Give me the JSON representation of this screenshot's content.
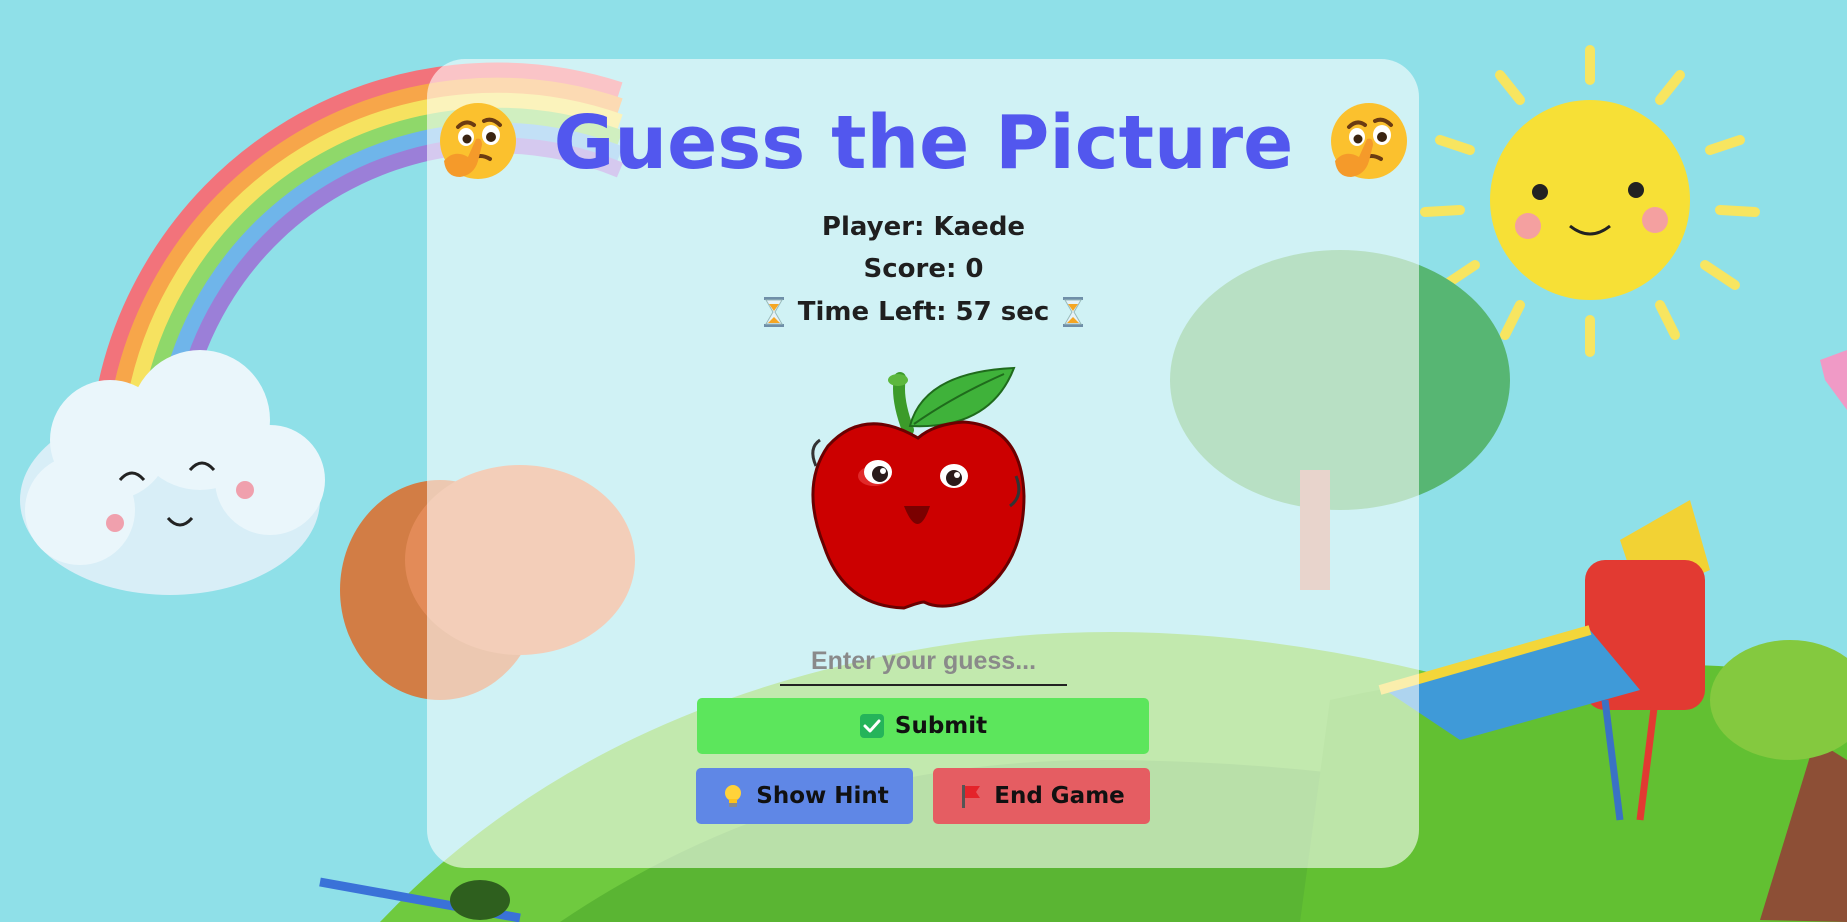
{
  "game": {
    "title": "Guess the Picture",
    "title_emoji_left": "thinking-face-emoji",
    "title_emoji_right": "thinking-face-emoji",
    "player_text": "Player: Kaede",
    "score_text": "Score: 0",
    "time_text": "Time Left: 57 sec",
    "time_icon": "hourglass-icon",
    "picture_subject_icon": "cartoon-apple-image",
    "guess": {
      "value": "",
      "placeholder": "Enter your guess..."
    },
    "buttons": {
      "submit_label": "Submit",
      "submit_icon": "check-box-icon",
      "hint_label": "Show Hint",
      "hint_icon": "light-bulb-icon",
      "end_label": "End Game",
      "end_icon": "red-flag-icon"
    }
  },
  "colors": {
    "title": "#5257ee",
    "submit": "#5ce65c",
    "hint": "#5f87e6",
    "end": "#e55d62",
    "sky": "#8fe0e8",
    "grass": "#63c23a"
  }
}
